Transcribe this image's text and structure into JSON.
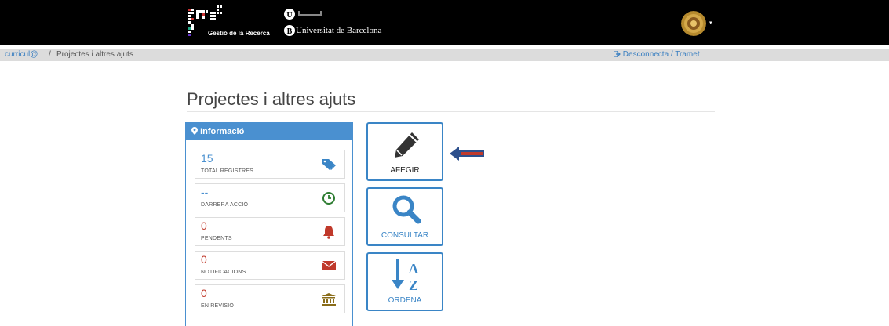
{
  "header": {
    "app_logo_text": "grec",
    "app_logo_subtitle": "Gestió de la Recerca",
    "university_name": "Universitat de Barcelona",
    "user_menu_caret": "▾"
  },
  "breadcrumb": {
    "root": "curricul@",
    "separator": "/",
    "current": "Projectes i altres ajuts",
    "logout": "Desconnecta / Tramet"
  },
  "page": {
    "title": "Projectes i altres ajuts"
  },
  "info_panel": {
    "title": "Informació",
    "stats": [
      {
        "value": "15",
        "label": "TOTAL REGISTRES",
        "icon": "tags-icon"
      },
      {
        "value": "--",
        "label": "DARRERA ACCIÓ",
        "icon": "clock-icon"
      },
      {
        "value": "0",
        "label": "PENDENTS",
        "icon": "bell-icon"
      },
      {
        "value": "0",
        "label": "NOTIFICACIONS",
        "icon": "envelope-icon"
      },
      {
        "value": "0",
        "label": "EN REVISIÓ",
        "icon": "bank-icon"
      }
    ]
  },
  "actions": [
    {
      "label": "AFEGIR",
      "icon": "pencil-icon"
    },
    {
      "label": "CONSULTAR",
      "icon": "search-icon"
    },
    {
      "label": "ORDENA",
      "icon": "sort-alpha-icon"
    }
  ],
  "colors": {
    "accent": "#4a90d0",
    "alert": "#c0392b",
    "success": "#2e7d32",
    "bank": "#8a6d1a"
  }
}
